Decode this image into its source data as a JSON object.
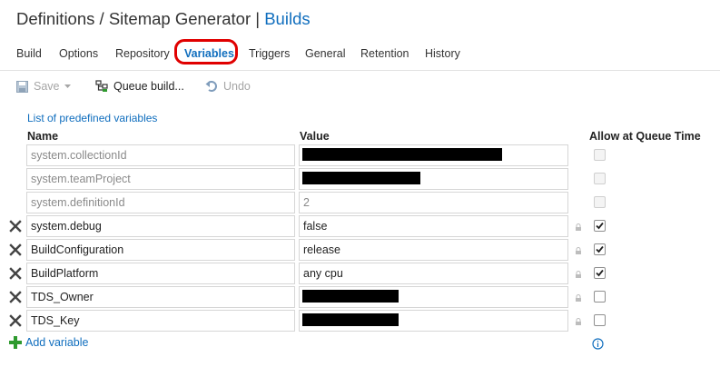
{
  "breadcrumb": {
    "definitions": "Definitions",
    "separator1": "/",
    "definition_name": "Sitemap Generator",
    "separator2": "|",
    "current": "Builds"
  },
  "tabs": [
    {
      "label": "Build",
      "active": false
    },
    {
      "label": "Options",
      "active": false
    },
    {
      "label": "Repository",
      "active": false
    },
    {
      "label": "Variables",
      "active": true
    },
    {
      "label": "Triggers",
      "active": false
    },
    {
      "label": "General",
      "active": false
    },
    {
      "label": "Retention",
      "active": false
    },
    {
      "label": "History",
      "active": false
    }
  ],
  "toolbar": {
    "save_label": "Save",
    "queue_label": "Queue build...",
    "undo_label": "Undo"
  },
  "predefined_link": "List of predefined variables",
  "columns": {
    "name": "Name",
    "value": "Value",
    "allow": "Allow at Queue Time"
  },
  "variables": [
    {
      "name": "system.collectionId",
      "value": "",
      "redacted": true,
      "readonly": true,
      "allow_queue_time": false
    },
    {
      "name": "system.teamProject",
      "value": "",
      "redacted": true,
      "readonly": true,
      "allow_queue_time": false
    },
    {
      "name": "system.definitionId",
      "value": "2",
      "redacted": false,
      "readonly": true,
      "allow_queue_time": false
    },
    {
      "name": "system.debug",
      "value": "false",
      "redacted": false,
      "readonly": false,
      "allow_queue_time": true
    },
    {
      "name": "BuildConfiguration",
      "value": "release",
      "redacted": false,
      "readonly": false,
      "allow_queue_time": true
    },
    {
      "name": "BuildPlatform",
      "value": "any cpu",
      "redacted": false,
      "readonly": false,
      "allow_queue_time": true
    },
    {
      "name": "TDS_Owner",
      "value": "",
      "redacted": true,
      "readonly": false,
      "allow_queue_time": false
    },
    {
      "name": "TDS_Key",
      "value": "",
      "redacted": true,
      "readonly": false,
      "allow_queue_time": false
    }
  ],
  "add_variable_label": "Add variable",
  "colors": {
    "link": "#106ebe",
    "highlight": "#e00000",
    "add_icon": "#2e9a2e"
  }
}
